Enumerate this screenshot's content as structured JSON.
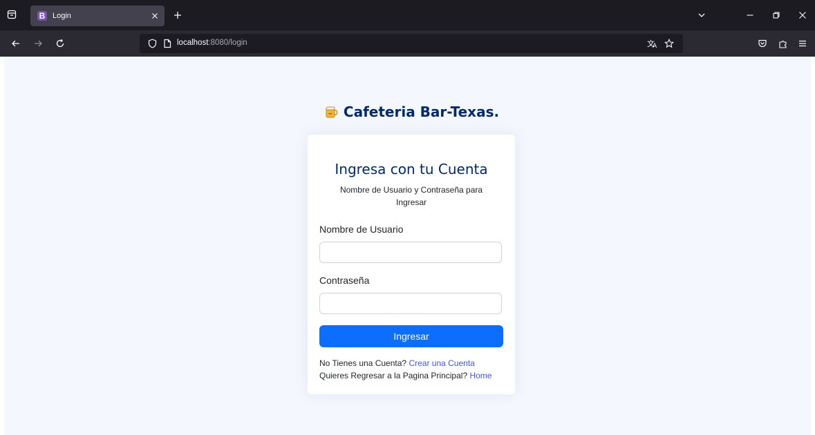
{
  "browser": {
    "tab": {
      "favicon": "B",
      "title": "Login",
      "favicon_color": "#7952b3"
    },
    "url": {
      "host": "localhost",
      "rest": ":8080/login"
    }
  },
  "page": {
    "brand": {
      "icon": "beer-mug-icon",
      "name": "Cafeteria Bar-Texas."
    },
    "card": {
      "title": "Ingresa con tu Cuenta",
      "subtitle": "Nombre de Usuario y Contraseña para Ingresar",
      "username_label": "Nombre de Usuario",
      "username_value": "",
      "password_label": "Contraseña",
      "password_value": "",
      "submit_label": "Ingresar",
      "register_prompt": "No Tienes una Cuenta?",
      "register_link": "Crear una Cuenta",
      "home_prompt": "Quieres Regresar a la Pagina Principal?",
      "home_link": "Home"
    }
  },
  "colors": {
    "primary": "#0d6efd",
    "brand": "#012970",
    "link": "#4154f1",
    "page_bg": "#f4f7fd"
  }
}
